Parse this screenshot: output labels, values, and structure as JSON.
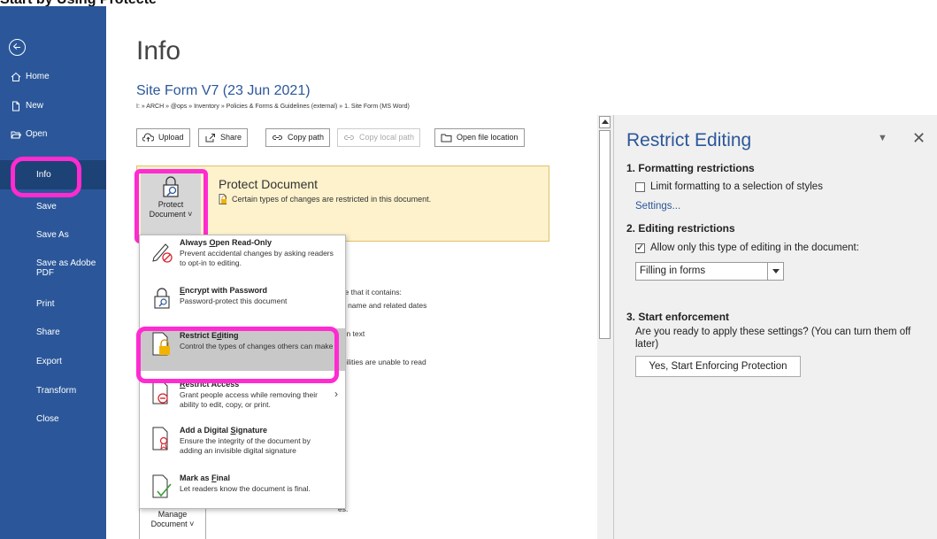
{
  "page": {
    "caption": "Start by Using Protecte"
  },
  "sidebar": {
    "items": [
      {
        "label": "Home",
        "icon": "home-icon"
      },
      {
        "label": "New",
        "icon": "new-document-icon"
      },
      {
        "label": "Open",
        "icon": "folder-open-icon"
      },
      {
        "label": "Info",
        "active": true
      },
      {
        "label": "Save"
      },
      {
        "label": "Save As"
      },
      {
        "label": "Save as Adobe PDF"
      },
      {
        "label": "Print"
      },
      {
        "label": "Share"
      },
      {
        "label": "Export"
      },
      {
        "label": "Transform"
      },
      {
        "label": "Close"
      }
    ],
    "colors": {
      "bg": "#2b579a",
      "active_bg": "#1d4276"
    }
  },
  "main": {
    "title": "Info",
    "doc_title": "Site Form V7 (23 Jun 2021)",
    "breadcrumb": "I: » ARCH » @ops » Inventory » Policies & Forms & Guidelines (external) » 1. Site Form (MS Word)",
    "buttons": [
      {
        "label": "Upload",
        "icon": "upload-icon"
      },
      {
        "label": "Share",
        "icon": "share-icon"
      },
      {
        "label": "Copy path",
        "icon": "link-icon"
      },
      {
        "label": "Copy local path",
        "icon": "link-icon",
        "disabled": true
      },
      {
        "label": "Open file location",
        "icon": "folder-icon"
      }
    ],
    "protect": {
      "button_line1": "Protect",
      "button_line2": "Document ˅",
      "heading": "Protect Document",
      "description": "Certain types of changes are restricted in this document."
    },
    "background_fragments": [
      "are that it contains:",
      "r's name and related dates",
      "den text",
      "abilities are unable to read",
      "s.",
      "es."
    ],
    "manage": {
      "line1": "Manage",
      "line2": "Document ˅"
    },
    "highlight_color": "#ff2bd0"
  },
  "protect_menu": [
    {
      "title": "Always Open Read-Only",
      "access_key": "O",
      "desc": "Prevent accidental changes by asking readers to opt-in to editing.",
      "icon": "read-only-pen-icon"
    },
    {
      "title": "Encrypt with Password",
      "access_key": "E",
      "desc": "Password-protect this document",
      "icon": "lock-key-icon"
    },
    {
      "title": "Restrict Editing",
      "access_key": "d",
      "desc": "Control the types of changes others can make",
      "icon": "restrict-editing-icon",
      "selected": true
    },
    {
      "title": "Restrict Access",
      "access_key": "R",
      "desc": "Grant people access while removing their ability to edit, copy, or print.",
      "icon": "restrict-access-icon",
      "has_submenu": true
    },
    {
      "title": "Add a Digital Signature",
      "access_key": "S",
      "desc": "Ensure the integrity of the document by adding an invisible digital signature",
      "icon": "digital-signature-icon"
    },
    {
      "title": "Mark as Final",
      "access_key": "F",
      "desc": "Let readers know the document is final.",
      "icon": "mark-final-icon"
    }
  ],
  "restrict_pane": {
    "title": "Restrict Editing",
    "section1": {
      "heading": "1. Formatting restrictions",
      "checkbox_label": "Limit formatting to a selection of styles",
      "checked": false,
      "link": "Settings..."
    },
    "section2": {
      "heading": "2. Editing restrictions",
      "checkbox_label": "Allow only this type of editing in the document:",
      "checked": true,
      "dropdown_value": "Filling in forms"
    },
    "section3": {
      "heading": "3. Start enforcement",
      "text_line1": "Are you ready to apply these settings? (You can turn them off",
      "text_line2": "later)",
      "button_label": "Yes, Start Enforcing Protection"
    }
  }
}
